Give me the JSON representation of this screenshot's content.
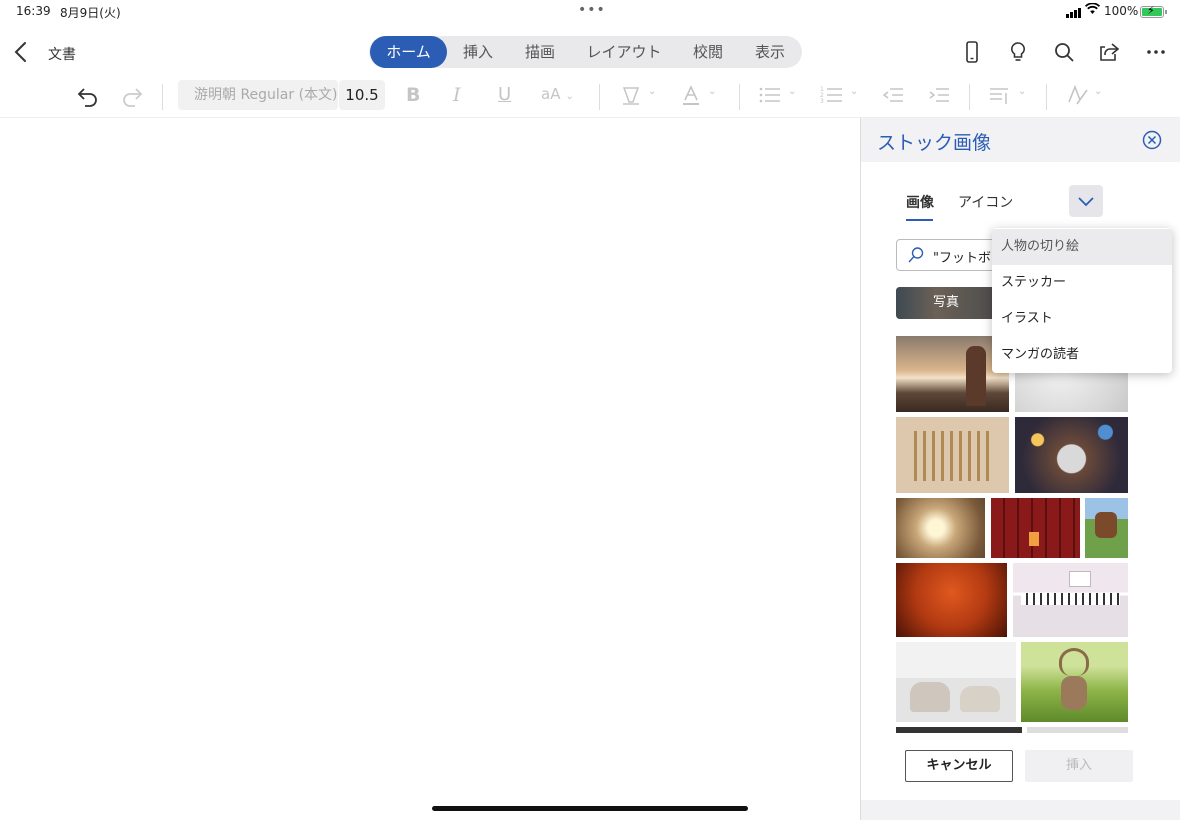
{
  "status_bar": {
    "time": "16:39",
    "date": "8月9日(火)",
    "battery": "100%"
  },
  "nav": {
    "document_title": "文書",
    "tabs": [
      "ホーム",
      "挿入",
      "描画",
      "レイアウト",
      "校閲",
      "表示"
    ],
    "active_tab": "ホーム"
  },
  "toolbar": {
    "font_name": "游明朝 Regular (本文)",
    "font_size": "10.5"
  },
  "panel": {
    "title": "ストック画像",
    "tabs": [
      "画像",
      "アイコン"
    ],
    "active_tab": "画像",
    "search_value": "\"フットボール\"",
    "chip_label": "写真",
    "cancel_label": "キャンセル",
    "insert_label": "挿入"
  },
  "dropdown": {
    "items": [
      "人物の切り絵",
      "ステッカー",
      "イラスト",
      "マンガの読者"
    ],
    "highlighted": "人物の切り絵"
  },
  "colors": {
    "accent": "#2b5db5",
    "panel_header": "#f2f2f4"
  },
  "icons": [
    "back-arrow-icon",
    "phone-icon",
    "lightbulb-icon",
    "search-icon",
    "share-icon",
    "more-icon",
    "undo-icon",
    "redo-icon",
    "bold-icon",
    "italic-icon",
    "underline-icon",
    "font-size-icon",
    "highlighter-icon",
    "font-color-icon",
    "bullets-icon",
    "numbering-icon",
    "outdent-icon",
    "indent-icon",
    "paragraph-icon",
    "styles-icon",
    "close-circle-icon",
    "chevron-down-icon",
    "magnifier-icon"
  ]
}
